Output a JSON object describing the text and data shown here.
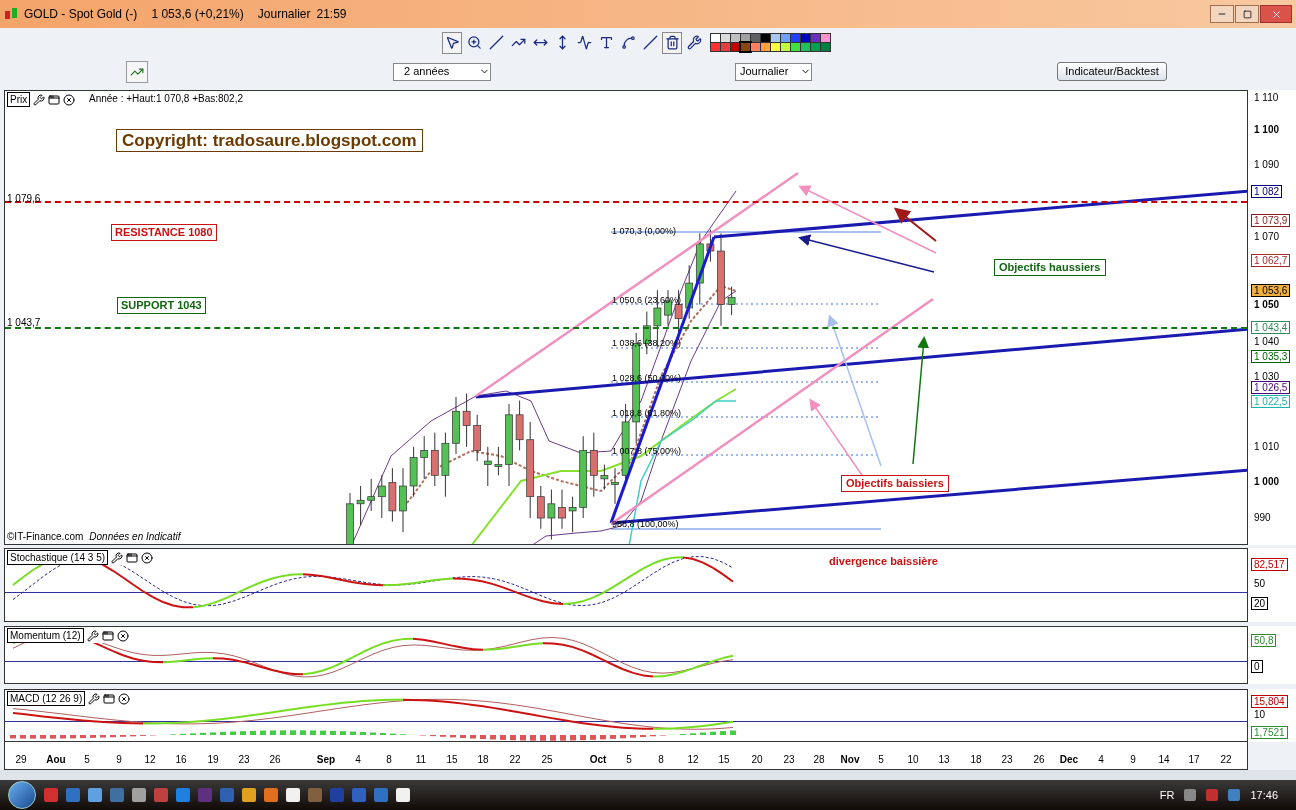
{
  "window": {
    "title": "GOLD - Spot Gold (-)",
    "quote": "1 053,6 (+0,21%)",
    "period": "Journalier",
    "time": "21:59"
  },
  "toolbar": {
    "tools": [
      {
        "kind": "pointer",
        "selected": true
      },
      {
        "kind": "zoom",
        "selected": false
      },
      {
        "kind": "segment",
        "selected": false
      },
      {
        "kind": "ray",
        "selected": false
      },
      {
        "kind": "horizontal",
        "selected": false
      },
      {
        "kind": "vertical",
        "selected": false
      },
      {
        "kind": "fibonacci",
        "selected": false
      },
      {
        "kind": "text",
        "selected": false
      },
      {
        "kind": "channel",
        "selected": false
      },
      {
        "kind": "parallel",
        "selected": false
      },
      {
        "kind": "delete",
        "selected": true
      },
      {
        "kind": "tools",
        "selected": false
      }
    ],
    "palette": [
      {
        "color": "#ffffff",
        "selected": false
      },
      {
        "color": "#dcdcdc",
        "selected": false
      },
      {
        "color": "#c0c0c0",
        "selected": false
      },
      {
        "color": "#a0a0a0",
        "selected": false
      },
      {
        "color": "#606060",
        "selected": false
      },
      {
        "color": "#000000",
        "selected": false
      },
      {
        "color": "#a8c8f0",
        "selected": false
      },
      {
        "color": "#6fa0ff",
        "selected": false
      },
      {
        "color": "#2040ff",
        "selected": false
      },
      {
        "color": "#0000c0",
        "selected": false
      },
      {
        "color": "#6a2fc0",
        "selected": false
      },
      {
        "color": "#ff8fd0",
        "selected": false
      },
      {
        "color": "#ff3030",
        "selected": false
      },
      {
        "color": "#e04040",
        "selected": false
      },
      {
        "color": "#c00000",
        "selected": false
      },
      {
        "color": "#8b4513",
        "selected": true
      },
      {
        "color": "#ff8060",
        "selected": false
      },
      {
        "color": "#ffa040",
        "selected": false
      },
      {
        "color": "#ffff40",
        "selected": false
      },
      {
        "color": "#c0ff40",
        "selected": false
      },
      {
        "color": "#40e040",
        "selected": false
      },
      {
        "color": "#20c060",
        "selected": false
      },
      {
        "color": "#00a050",
        "selected": false
      },
      {
        "color": "#008040",
        "selected": false
      }
    ]
  },
  "controls": {
    "range": "2 années",
    "interval": "Journalier",
    "button": "Indicateur/Backtest"
  },
  "price_panel": {
    "title": "Prix",
    "info": "Année : +Haut:1 070,8 +Bas:802,2",
    "annotations": [
      {
        "text": "Copyright: tradosaure.blogspot.com",
        "color": "#6b3a00"
      },
      {
        "text": "RESISTANCE 1080",
        "color": "#cc1111"
      },
      {
        "text": "SUPPORT 1043",
        "color": "#116611"
      },
      {
        "text": "Objectifs haussiers",
        "color": "#116611"
      },
      {
        "text": "Objectifs baissiers",
        "color": "#cc1111"
      }
    ],
    "levels": [
      {
        "label": "1 079,6",
        "color": "#cc0000"
      },
      {
        "label": "1 043,7",
        "color": "#117711"
      }
    ],
    "fib_labels": [
      "1 070,3 (0,00%)",
      "1 050,6 (23,60%)",
      "1 038,6 (38,20%)",
      "1 028,6 (50,00%)",
      "1 018,8 (61,80%)",
      "1 007,8 (75,00%)",
      "988,8 (100,00%)"
    ],
    "axis_ticks": [
      {
        "label": "1 110",
        "major": false
      },
      {
        "label": "1 100",
        "major": true
      },
      {
        "label": "1 090",
        "major": false
      },
      {
        "label": "1 070",
        "major": false
      },
      {
        "label": "1 050",
        "major": true
      },
      {
        "label": "1 040",
        "major": false
      },
      {
        "label": "1 030",
        "major": false
      },
      {
        "label": "1 010",
        "major": false
      },
      {
        "label": "1 000",
        "major": true
      },
      {
        "label": "990",
        "major": false
      }
    ],
    "axis_badges": [
      {
        "label": "1 082",
        "color": "#000080",
        "highlighted": false
      },
      {
        "label": "1 073,9",
        "color": "#8b1a1a",
        "highlighted": false
      },
      {
        "label": "1 062,7",
        "color": "#a52a2a",
        "highlighted": false
      },
      {
        "label": "1 053,6",
        "color": "#000000",
        "highlighted": true
      },
      {
        "label": "1 043,4",
        "color": "#2e8b57",
        "highlighted": false
      },
      {
        "label": "1 035,3",
        "color": "#006400",
        "highlighted": false
      },
      {
        "label": "1 026,5",
        "color": "#4b0082",
        "highlighted": false
      },
      {
        "label": "1 022,5",
        "color": "#20b2aa",
        "highlighted": false
      }
    ],
    "credit": "©IT-Finance.com",
    "disclaimer": "Données en Indicatif"
  },
  "indicators": [
    {
      "kind": "stochastic",
      "title": "Stochastique (14 3 5)",
      "note": "divergence baissière",
      "axis": [
        {
          "label": "82,517",
          "kind": "badge",
          "color": "#c00000"
        },
        {
          "label": "50",
          "kind": "tick"
        },
        {
          "label": "20",
          "kind": "badge",
          "color": "#000000"
        }
      ]
    },
    {
      "kind": "momentum",
      "title": "Momentum (12)",
      "axis": [
        {
          "label": "50,8",
          "kind": "badge",
          "color": "#2e8b2e"
        },
        {
          "label": "0",
          "kind": "badge",
          "color": "#000000"
        }
      ]
    },
    {
      "kind": "macd",
      "title": "MACD (12 26 9)",
      "axis": [
        {
          "label": "15,804",
          "kind": "badge",
          "color": "#c00000"
        },
        {
          "label": "10",
          "kind": "tick"
        },
        {
          "label": "1,7521",
          "kind": "badge",
          "color": "#2e8b2e"
        }
      ]
    }
  ],
  "x_axis": [
    {
      "label": "29",
      "major": false
    },
    {
      "label": "Aou",
      "major": true
    },
    {
      "label": "5",
      "major": false
    },
    {
      "label": "9",
      "major": false
    },
    {
      "label": "12",
      "major": false
    },
    {
      "label": "16",
      "major": false
    },
    {
      "label": "19",
      "major": false
    },
    {
      "label": "23",
      "major": false
    },
    {
      "label": "26",
      "major": false
    },
    {
      "label": "Sep",
      "major": true
    },
    {
      "label": "4",
      "major": false
    },
    {
      "label": "8",
      "major": false
    },
    {
      "label": "11",
      "major": false
    },
    {
      "label": "15",
      "major": false
    },
    {
      "label": "18",
      "major": false
    },
    {
      "label": "22",
      "major": false
    },
    {
      "label": "25",
      "major": false
    },
    {
      "label": "Oct",
      "major": true
    },
    {
      "label": "5",
      "major": false
    },
    {
      "label": "8",
      "major": false
    },
    {
      "label": "12",
      "major": false
    },
    {
      "label": "15",
      "major": false
    },
    {
      "label": "20",
      "major": false
    },
    {
      "label": "23",
      "major": false
    },
    {
      "label": "28",
      "major": false
    },
    {
      "label": "Nov",
      "major": true
    },
    {
      "label": "5",
      "major": false
    },
    {
      "label": "10",
      "major": false
    },
    {
      "label": "13",
      "major": false
    },
    {
      "label": "18",
      "major": false
    },
    {
      "label": "23",
      "major": false
    },
    {
      "label": "26",
      "major": false
    },
    {
      "label": "Dec",
      "major": true
    },
    {
      "label": "4",
      "major": false
    },
    {
      "label": "9",
      "major": false
    },
    {
      "label": "14",
      "major": false
    },
    {
      "label": "17",
      "major": false
    },
    {
      "label": "22",
      "major": false
    }
  ],
  "taskbar": {
    "language": "FR",
    "time": "17:46"
  }
}
